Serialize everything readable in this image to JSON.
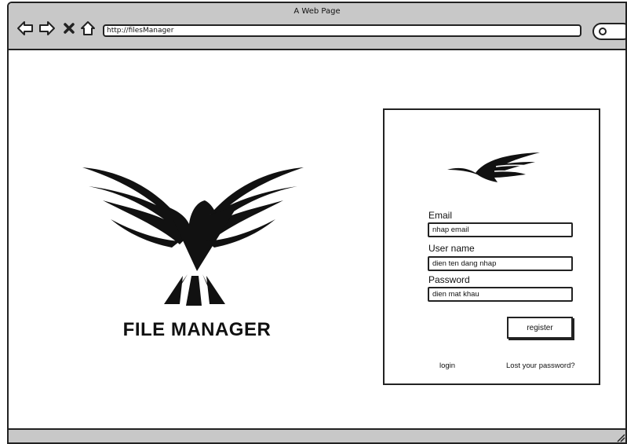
{
  "window": {
    "title": "A Web Page",
    "address": "http://filesManager"
  },
  "brand": {
    "name": "FILE MANAGER",
    "logo_icon": "eagle-logo-icon"
  },
  "form": {
    "logo_icon": "bird-logo-icon",
    "email_label": "Email",
    "email_value": "nhap email",
    "username_label": "User name",
    "username_value": "dien ten dang nhap",
    "password_label": "Password",
    "password_value": "dien mat khau",
    "register_label": "register",
    "login_label": "login",
    "lost_password_label": "Lost your password?"
  },
  "icons": {
    "back": "arrow-left-icon",
    "forward": "arrow-right-icon",
    "stop": "close-icon",
    "home": "home-icon",
    "search": "search-icon"
  },
  "colors": {
    "chrome": "#c8c8c8",
    "ink": "#111111"
  }
}
